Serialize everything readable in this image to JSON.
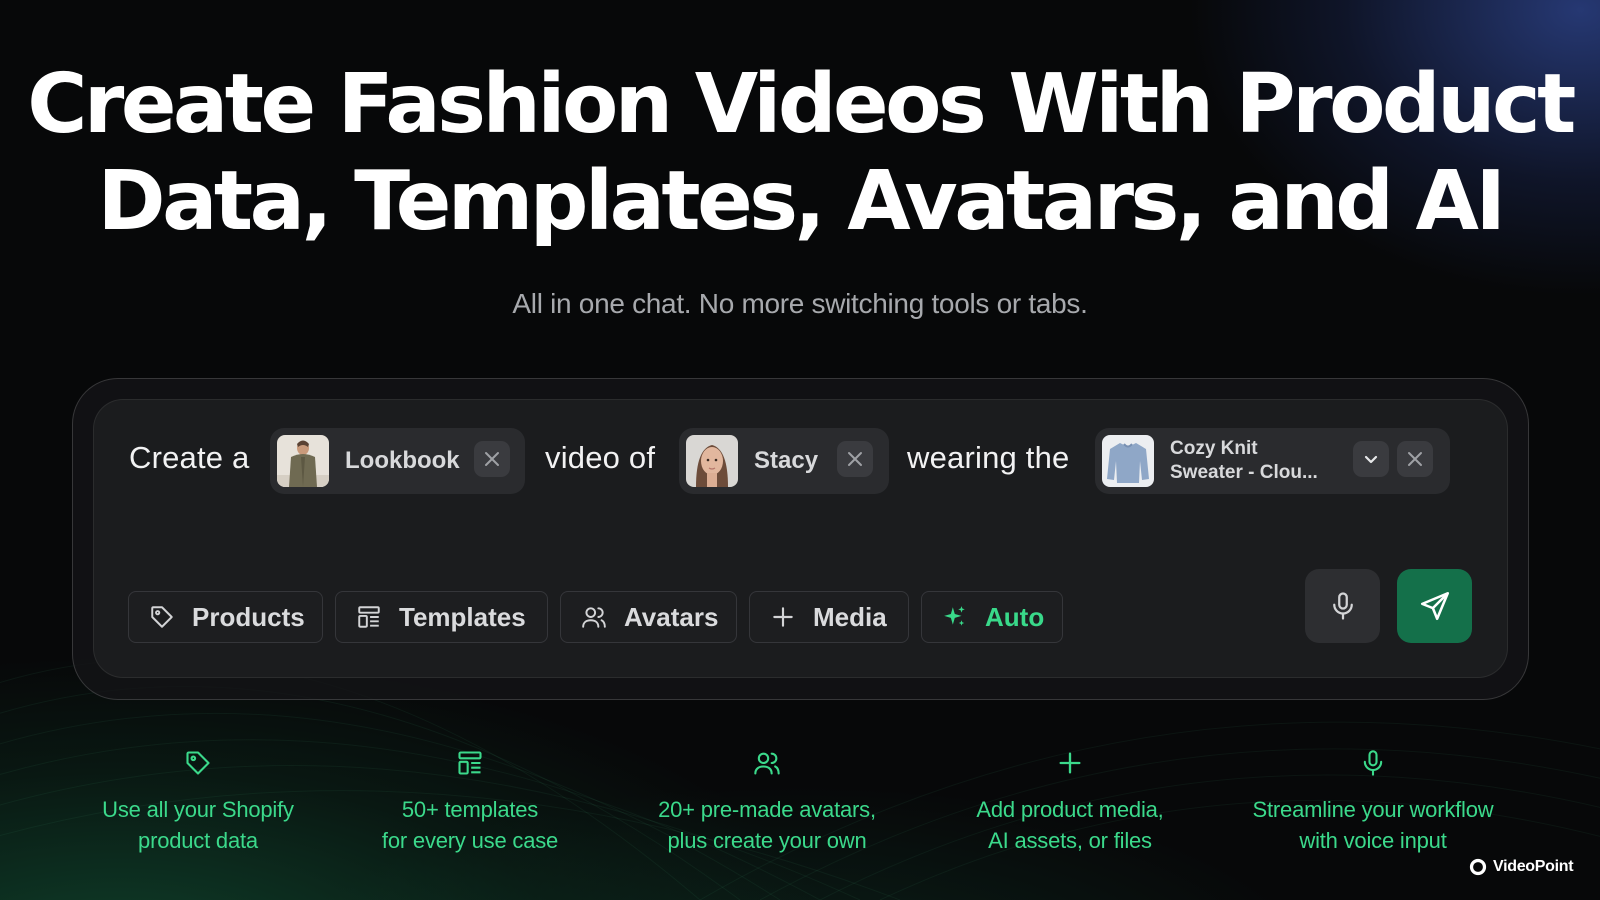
{
  "hero": {
    "title_line1": "Create Fashion Videos With Product",
    "title_line2": "Data, Templates, Avatars, and AI",
    "subtitle": "All in one chat. No more switching tools or tabs."
  },
  "prompt": {
    "text_1": "Create a",
    "chip_template": {
      "label": "Lookbook",
      "thumb": "jacket-model-thumbnail"
    },
    "text_2": "video of",
    "chip_avatar": {
      "label": "Stacy",
      "thumb": "avatar-face-thumbnail"
    },
    "text_3": "wearing the",
    "chip_product": {
      "label_line1": "Cozy Knit",
      "label_line2": "Sweater - Clou...",
      "thumb": "sweater-thumbnail"
    }
  },
  "toolbar": {
    "products": {
      "label": "Products",
      "icon": "tag-icon"
    },
    "templates": {
      "label": "Templates",
      "icon": "template-icon"
    },
    "avatars": {
      "label": "Avatars",
      "icon": "users-icon"
    },
    "media": {
      "label": "Media",
      "icon": "plus-icon"
    },
    "auto": {
      "label": "Auto",
      "icon": "sparkles-icon"
    }
  },
  "features": [
    {
      "icon": "tag-icon",
      "line1": "Use all your Shopify",
      "line2": "product data"
    },
    {
      "icon": "template-icon",
      "line1": "50+ templates",
      "line2": "for every use case"
    },
    {
      "icon": "users-icon",
      "line1": "20+ pre-made avatars,",
      "line2": "plus create your own"
    },
    {
      "icon": "plus-icon",
      "line1": "Add product media,",
      "line2": "AI assets, or files"
    },
    {
      "icon": "mic-icon",
      "line1": "Streamline your workflow",
      "line2": "with voice input"
    }
  ],
  "brand": {
    "name": "VideoPoint"
  },
  "colors": {
    "accent_green": "#39d98a",
    "send_button": "#14704a",
    "background": "#070809"
  }
}
